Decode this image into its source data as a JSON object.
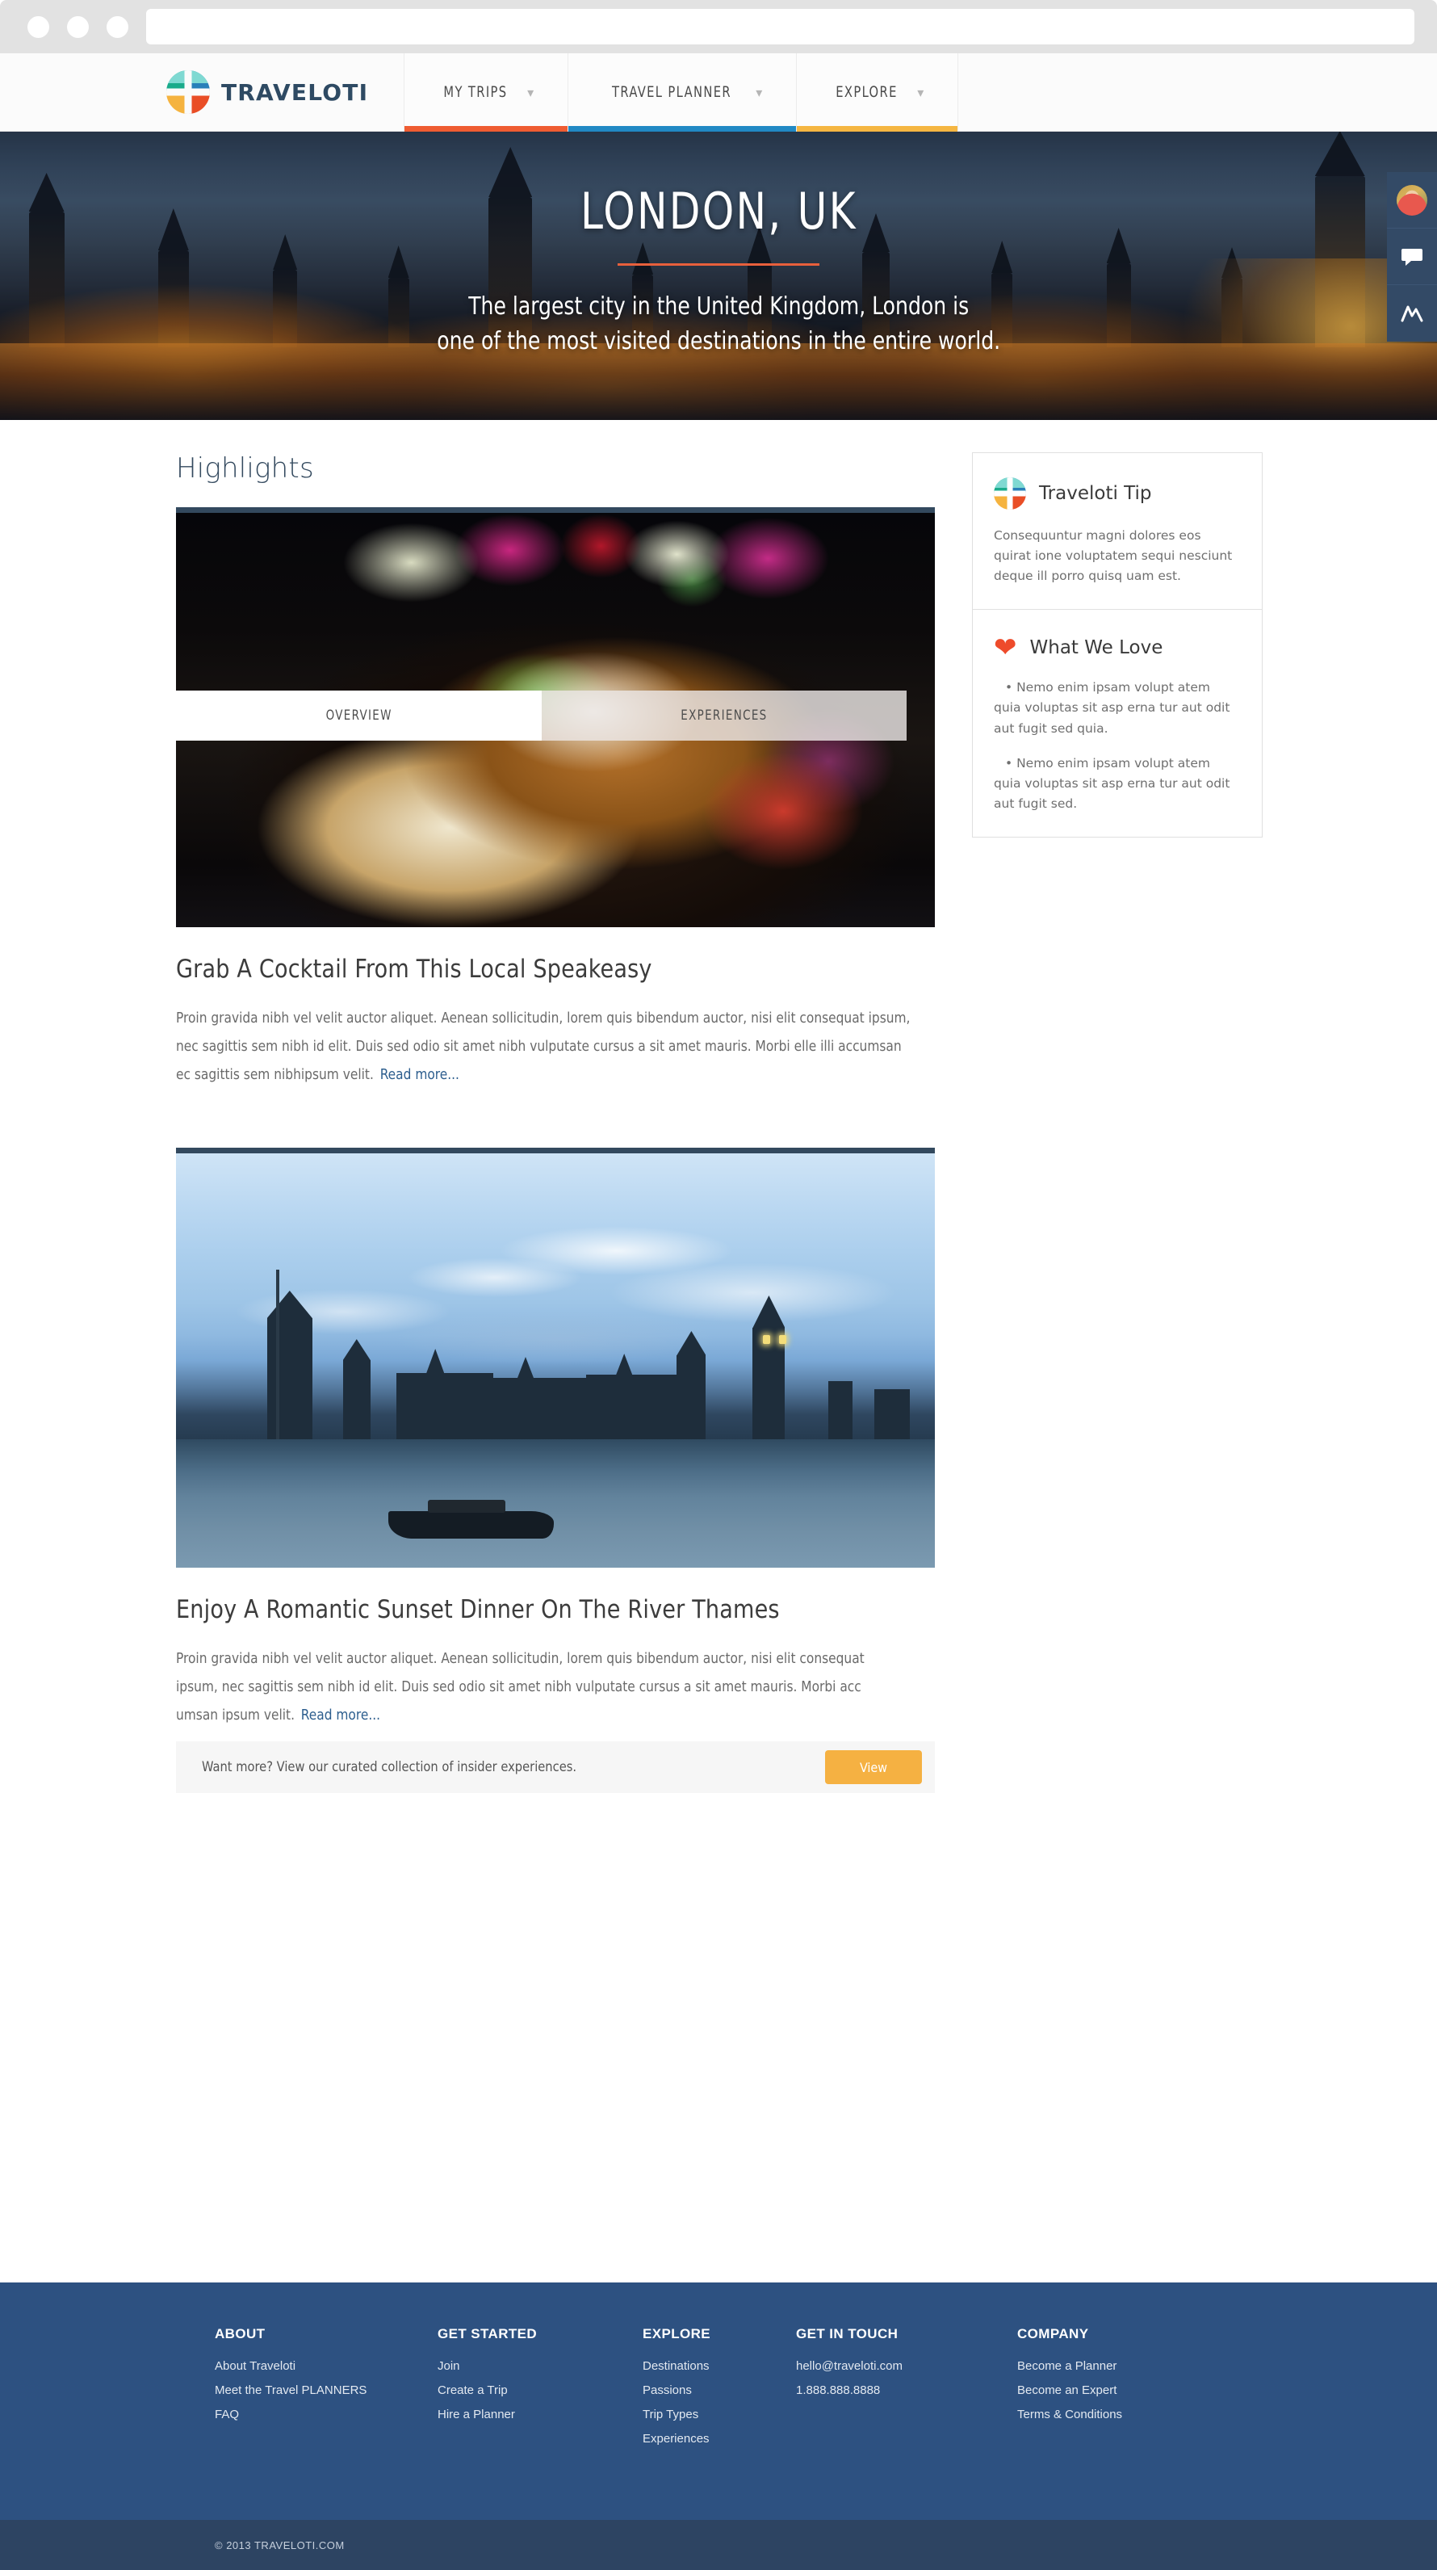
{
  "browser": {
    "url_value": "",
    "url_placeholder": ""
  },
  "nav": {
    "brand_name": "TRAVELOTI",
    "items": [
      {
        "label": "MY TRIPS",
        "caret": "chevron-down-icon",
        "accent": "#ef5c32"
      },
      {
        "label": "TRAVEL PLANNER",
        "caret": "chevron-down-icon",
        "accent": "#2189c4"
      },
      {
        "label": "EXPLORE",
        "caret": "chevron-down-icon",
        "accent": "#f5b642"
      }
    ]
  },
  "right_rail": {
    "items": [
      {
        "name": "user-avatar",
        "label": ""
      },
      {
        "name": "chat-icon",
        "label": ""
      },
      {
        "name": "activity-icon",
        "label": ""
      }
    ]
  },
  "hero": {
    "title": "LONDON, UK",
    "subtitle_line1": "The largest city in the United Kingdom, London is",
    "subtitle_line2": "one of the most visited destinations in the entire world.",
    "rule_color": "#e8603c"
  },
  "tabs": [
    {
      "label": "OVERVIEW",
      "active": true
    },
    {
      "label": "EXPERIENCES",
      "active": false
    }
  ],
  "main": {
    "section_title": "Highlights",
    "articles": [
      {
        "image": "plated-pasta-photo",
        "title": "Grab A Cocktail From This Local Speakeasy",
        "body": "Proin gravida nibh vel velit auctor aliquet. Aenean sollicitudin, lorem quis bibendum auctor, nisi elit consequat ipsum, nec sagittis sem nibh id elit. Duis sed odio sit amet nibh vulputate cursus a sit amet mauris. Morbi elle illi accumsan ec sagittis sem nibhipsum velit.",
        "read_more": "Read more..."
      },
      {
        "image": "river-thames-photo",
        "title": "Enjoy A Romantic Sunset Dinner On The River Thames",
        "body": "Proin gravida nibh vel velit auctor aliquet. Aenean sollicitudin, lorem quis bibendum auctor, nisi elit consequat ipsum, nec sagittis sem nibh id elit. Duis sed odio sit amet nibh vulputate cursus a sit amet mauris. Morbi acc umsan ipsum velit.",
        "read_more": "Read more..."
      }
    ],
    "cta": {
      "text": "Want more?  View our curated collection of insider experiences.",
      "button_label": "View",
      "button_color": "#f5b142"
    }
  },
  "sidebar": {
    "tip": {
      "icon": "traveloti-logo-icon",
      "title": "Traveloti Tip",
      "body": "Consequuntur magni dolores eos quirat ione voluptatem sequi nesciunt deque ill porro quisq uam est."
    },
    "love": {
      "icon": "heart-icon",
      "title": "What We Love",
      "bullets": [
        "• Nemo enim ipsam volupt atem quia voluptas sit asp erna tur aut odit aut fugit sed quia.",
        "• Nemo enim ipsam volupt atem quia voluptas sit asp erna tur aut odit aut fugit sed."
      ]
    }
  },
  "footer": {
    "columns": [
      {
        "heading": "ABOUT",
        "links": [
          "About Traveloti",
          "Meet the Travel PLANNERS",
          "FAQ"
        ]
      },
      {
        "heading": "GET STARTED",
        "links": [
          "Join",
          "Create a Trip",
          "Hire a Planner"
        ]
      },
      {
        "heading": "EXPLORE",
        "links": [
          "Destinations",
          "Passions",
          "Trip Types",
          "Experiences"
        ]
      },
      {
        "heading": "GET IN TOUCH",
        "links": [
          "hello@traveloti.com",
          "1.888.888.8888"
        ]
      },
      {
        "heading": "COMPANY",
        "links": [
          "Become a Planner",
          "Become an Expert",
          "Terms & Conditions"
        ]
      }
    ],
    "copyright": "© 2013 TRAVELOTI.COM",
    "bg_color": "#2d5181",
    "bar_color": "#2d4462"
  }
}
